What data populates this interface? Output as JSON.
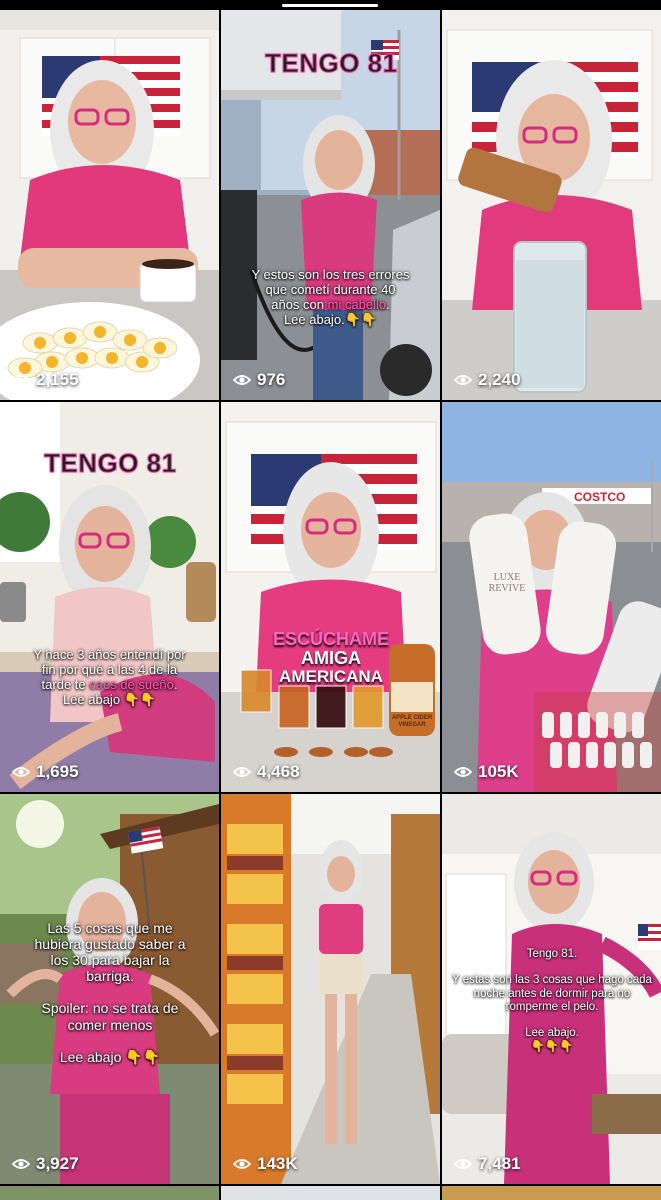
{
  "tiles": [
    {
      "views": "2,155"
    },
    {
      "views": "976",
      "tengo": "TENGO 81",
      "caption_pre": "Y estos son los tres errores\nque cometí durante 40\naños con ",
      "caption_highlight": "mi cabello",
      "caption_post": ".\nLee abajo.👇👇"
    },
    {
      "views": "2,240"
    },
    {
      "views": "1,695",
      "tengo": "TENGO 81",
      "caption_pre": "Y hace 3 años entendí por\nfin por qué a las 4 de la\ntarde te ",
      "caption_highlight": "caes de sueño",
      "caption_post": ".\nLee abajo 👇👇"
    },
    {
      "views": "4,468",
      "overlay_line1": "ESCÚCHAME",
      "overlay_line2": "AMIGA",
      "overlay_line3": "AMERICANA",
      "vinegar_label": "APPLE CIDER VINEGAR"
    },
    {
      "views": "105K",
      "store_sign": "COSTCO",
      "bottle_label": "LUXE REVIVE"
    },
    {
      "views": "3,927",
      "caption": "Las 5 cosas que me\nhubiera gustado saber a\nlos 30 para bajar la\nbarriga.\n\nSpoiler: no se trata de\ncomer menos\n\nLee abajo 👇👇"
    },
    {
      "views": "143K"
    },
    {
      "views": "7,481",
      "caption": "Tengo 81.\n\nY estas son las 3 cosas que hago cada\nnoche antes de dormir para no\nromperme el pelo.\n\nLee abajo.\n👇👇👇"
    }
  ]
}
